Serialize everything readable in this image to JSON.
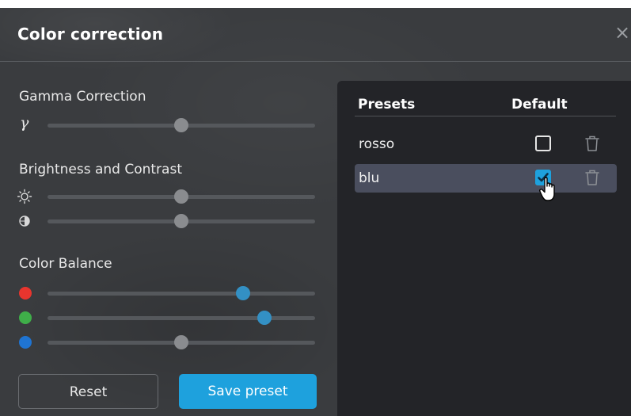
{
  "dialog": {
    "title": "Color correction",
    "close_symbol": "×"
  },
  "gamma": {
    "label": "Gamma Correction",
    "symbol": "γ",
    "value": 0.5
  },
  "brightness_contrast": {
    "label": "Brightness and Contrast",
    "brightness": {
      "icon": "sun-icon",
      "value": 0.5
    },
    "contrast": {
      "icon": "contrast-icon",
      "value": 0.5
    }
  },
  "color_balance": {
    "label": "Color Balance",
    "channels": [
      {
        "name": "red",
        "color": "#e8352e",
        "value": 0.73,
        "active": true
      },
      {
        "name": "green",
        "color": "#3fae49",
        "value": 0.81,
        "active": true
      },
      {
        "name": "blue",
        "color": "#1f74d2",
        "value": 0.5,
        "active": false
      }
    ]
  },
  "buttons": {
    "reset": "Reset",
    "save_preset": "Save preset"
  },
  "presets": {
    "header_presets": "Presets",
    "header_default": "Default",
    "rows": [
      {
        "name": "rosso",
        "default": false,
        "selected": false
      },
      {
        "name": "blu",
        "default": true,
        "selected": true
      }
    ]
  },
  "colors": {
    "accent": "#1ea1dd",
    "slider_thumb_active": "#3390c4",
    "panel_bg": "#232428",
    "dialog_bg": "#3a3c3f",
    "selected_row": "#4a4e5e"
  }
}
